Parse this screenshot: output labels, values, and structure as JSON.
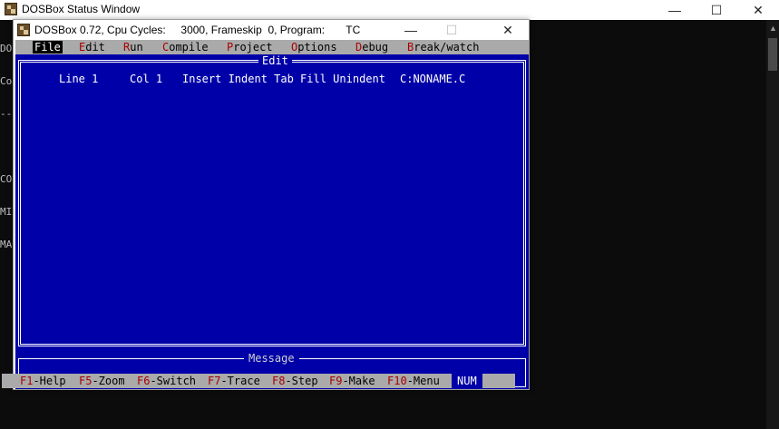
{
  "status_window": {
    "title": "DOSBox Status Window",
    "console_lines": [
      "DOS",
      "Cop",
      "---",
      "",
      "CON",
      "MID",
      "MAP"
    ]
  },
  "dosbox": {
    "title": "DOSBox 0.72, Cpu Cycles:     3000, Frameskip  0, Program:       TC"
  },
  "menu": [
    {
      "hot": "F",
      "rest": "ile",
      "active": true
    },
    {
      "hot": "E",
      "rest": "dit"
    },
    {
      "hot": "R",
      "rest": "un"
    },
    {
      "hot": "C",
      "rest": "ompile"
    },
    {
      "hot": "P",
      "rest": "roject"
    },
    {
      "hot": "O",
      "rest": "ptions"
    },
    {
      "hot": "D",
      "rest": "ebug"
    },
    {
      "hot": "B",
      "rest": "reak/watch"
    }
  ],
  "editor": {
    "frame_title": "Edit",
    "line": "Line 1",
    "col": "Col 1",
    "modes": "Insert Indent Tab Fill Unindent",
    "filename": "C:NONAME.C"
  },
  "message": {
    "frame_title": "Message"
  },
  "fkeys": [
    {
      "key": "F1",
      "label": "-Help"
    },
    {
      "key": "F5",
      "label": "-Zoom"
    },
    {
      "key": "F6",
      "label": "-Switch"
    },
    {
      "key": "F7",
      "label": "-Trace"
    },
    {
      "key": "F8",
      "label": "-Step"
    },
    {
      "key": "F9",
      "label": "-Make"
    },
    {
      "key": "F10",
      "label": "-Menu"
    }
  ],
  "num_indicator": "NUM",
  "window_controls": {
    "minimize": "—",
    "maximize": "☐",
    "close": "✕"
  },
  "colors": {
    "tc_blue": "#0000a8",
    "menu_gray": "#aaaaaa",
    "hotkey_red": "#a80000"
  }
}
